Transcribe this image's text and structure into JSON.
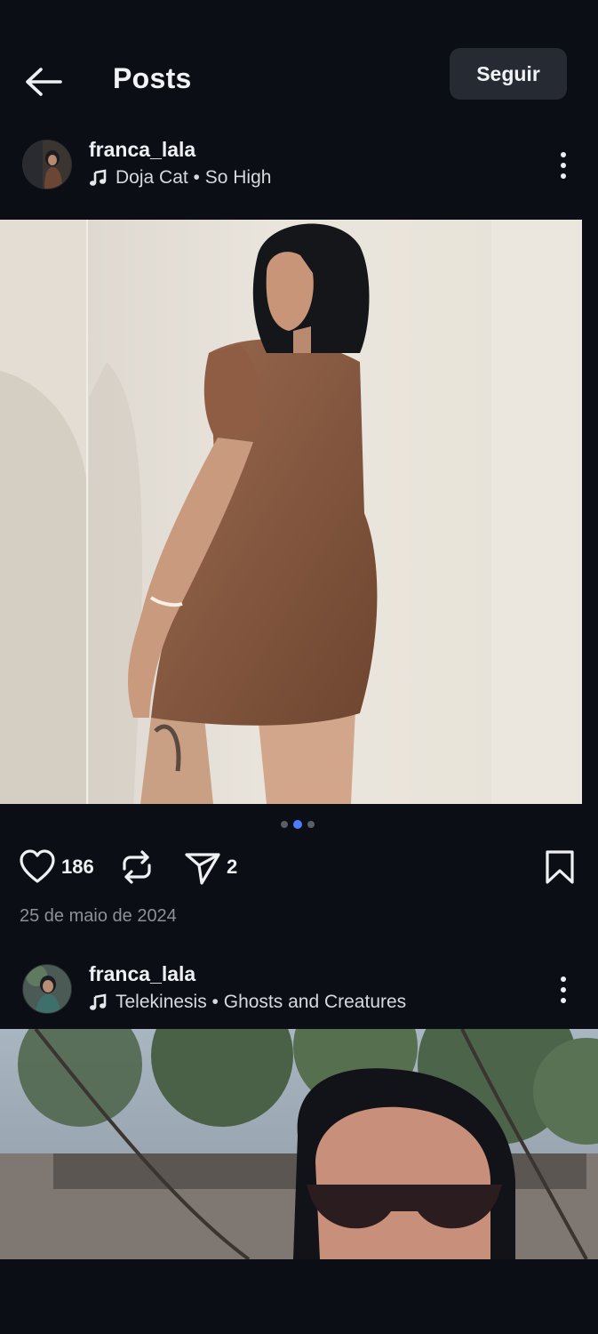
{
  "header": {
    "title": "Posts",
    "follow_label": "Seguir"
  },
  "posts": [
    {
      "username": "franca_lala",
      "music": "Doja Cat • So High",
      "likes": "186",
      "comments": "2",
      "date": "25 de maio de 2024",
      "carousel": {
        "count": 3,
        "active_index": 1
      }
    },
    {
      "username": "franca_lala",
      "music": "Telekinesis • Ghosts and Creatures"
    }
  ],
  "colors": {
    "background": "#0b0e14",
    "button_bg": "#262a33",
    "accent_dot": "#4f7cff",
    "muted_text": "#8d9099"
  },
  "icons": {
    "back": "arrow-left-icon",
    "more": "more-vertical-icon",
    "music": "music-note-icon",
    "like": "heart-icon",
    "repost": "repost-icon",
    "share": "send-icon",
    "save": "bookmark-icon"
  }
}
